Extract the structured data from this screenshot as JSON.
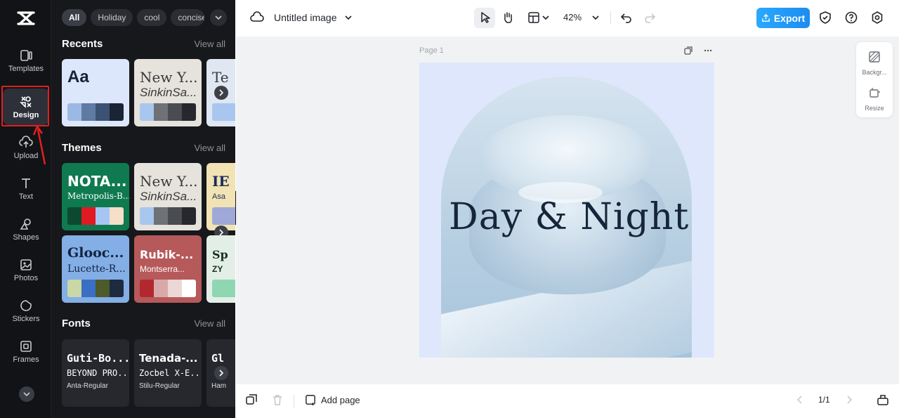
{
  "rail": {
    "items": [
      {
        "label": "Templates"
      },
      {
        "label": "Design"
      },
      {
        "label": "Upload"
      },
      {
        "label": "Text"
      },
      {
        "label": "Shapes"
      },
      {
        "label": "Photos"
      },
      {
        "label": "Stickers"
      },
      {
        "label": "Frames"
      }
    ],
    "highlight_color": "#e02020"
  },
  "panel": {
    "chips": [
      "All",
      "Holiday",
      "cool",
      "concise"
    ],
    "recents": {
      "title": "Recents",
      "view_all": "View all",
      "cards": [
        {
          "line1": "Aa",
          "line2": "",
          "bg": "#dde7fb",
          "fg": "#14233b",
          "swatches": [
            "#9bb9e3",
            "#5f7aa3",
            "#3c5273",
            "#1b2435"
          ]
        },
        {
          "line1": "New Y...",
          "line2": "SinkinSa...",
          "bg": "#e6e2dc",
          "fg": "#3a3a3a",
          "swatches": [
            "#a8c6ee",
            "#6e7176",
            "#4a4c52",
            "#26282d"
          ]
        },
        {
          "line1": "Te",
          "line2": "",
          "bg": "#dfe7f3",
          "fg": "#3a3a3a",
          "swatches": [
            "#a8c6ee"
          ]
        }
      ]
    },
    "themes": {
      "title": "Themes",
      "view_all": "View all",
      "cards": [
        {
          "line1": "NOTA...",
          "line2": "Metropolis-B...",
          "bg": "#0f7a4f",
          "fg": "#ffffff",
          "swatches": [
            "#0b4a31",
            "#e11a22",
            "#a5c6f2",
            "#f5dfc9"
          ]
        },
        {
          "line1": "New Y...",
          "line2": "SinkinSa...",
          "bg": "#e6e2dc",
          "fg": "#3a3a3a",
          "swatches": [
            "#a8c6ee",
            "#6e7176",
            "#4a4c52",
            "#26282d"
          ]
        },
        {
          "line1": "IE",
          "line2": "Asa",
          "bg": "#f1e3b3",
          "fg": "#1c2d5a",
          "swatches": [
            "#9fa8d8"
          ]
        },
        {
          "line1": "Glooc...",
          "line2": "Lucette-R...",
          "bg": "#83aee6",
          "fg": "#12243f",
          "swatches": [
            "#cad7a6",
            "#3a6fc4",
            "#4c5a2c",
            "#1c2b3f"
          ]
        },
        {
          "line1": "Rubik-...",
          "line2": "Montserra...",
          "bg": "#b6595a",
          "fg": "#ffffff",
          "swatches": [
            "#b3282f",
            "#d9a9a9",
            "#ecd7d7",
            "#ffffff"
          ]
        },
        {
          "line1": "Sp",
          "line2": "ZY",
          "bg": "#e3efe6",
          "fg": "#163022",
          "swatches": [
            "#8fd6b3"
          ]
        }
      ]
    },
    "fonts": {
      "title": "Fonts",
      "view_all": "View all",
      "cards": [
        {
          "line1": "Guti-Bo...",
          "line2": "BEYOND PRO...",
          "line3": "Anta-Regular"
        },
        {
          "line1": "Tenada-...",
          "line2": "Zocbel X-E...",
          "line3": "Stilu-Regular"
        },
        {
          "line1": "Gl",
          "line2": "",
          "line3": "Ham"
        }
      ]
    }
  },
  "topbar": {
    "title": "Untitled image",
    "zoom": "42%",
    "export_label": "Export",
    "export_color": "#1d8cf0"
  },
  "canvas": {
    "page_label": "Page 1",
    "headline": "Day & Night",
    "side_tools": [
      {
        "label": "Backgr..."
      },
      {
        "label": "Resize"
      }
    ]
  },
  "bottombar": {
    "add_page": "Add page",
    "pager": "1/1"
  }
}
